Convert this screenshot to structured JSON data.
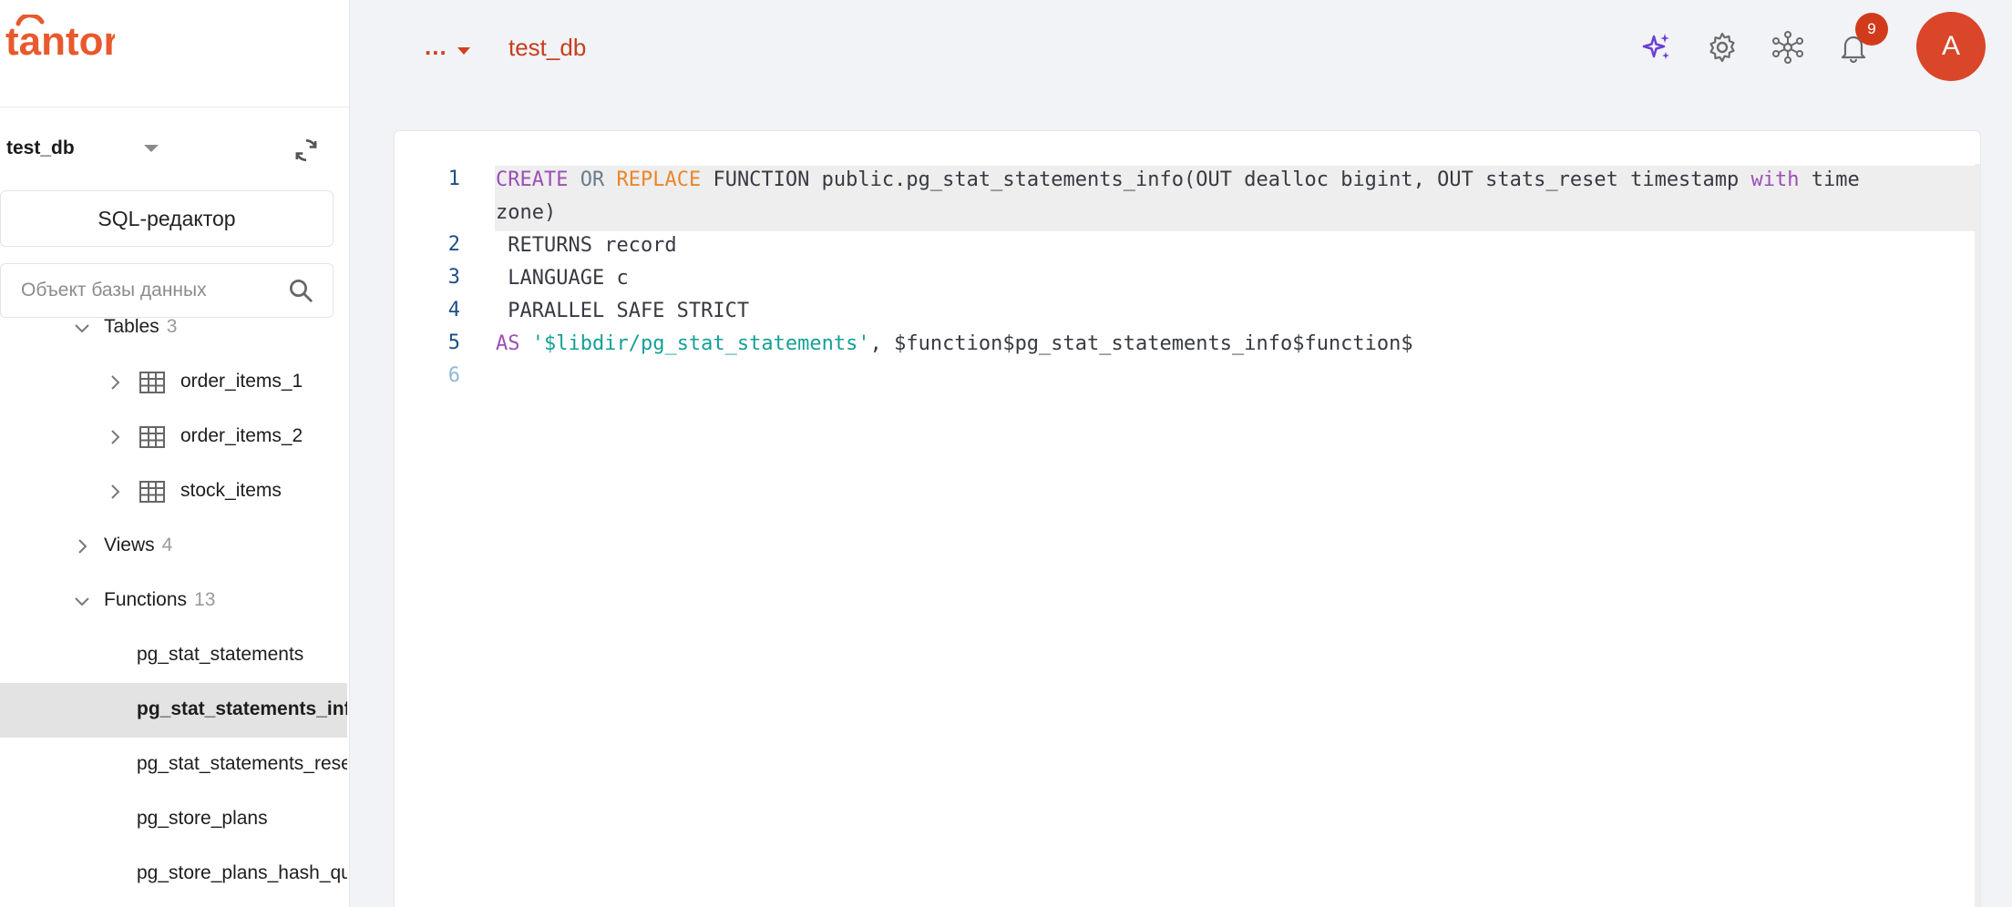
{
  "sidebar": {
    "db_selector": {
      "value": "test_db"
    },
    "sql_editor_button": "SQL-редактор",
    "search": {
      "placeholder": "Объект базы данных",
      "value": ""
    },
    "tree": [
      {
        "label": "Tables",
        "count": "3",
        "expanded": true
      },
      {
        "label": "order_items_1"
      },
      {
        "label": "order_items_2"
      },
      {
        "label": "stock_items"
      },
      {
        "label": "Views",
        "count": "4",
        "expanded": false
      },
      {
        "label": "Functions",
        "count": "13",
        "expanded": true
      },
      {
        "label": "pg_stat_statements"
      },
      {
        "label": "pg_stat_statements_info",
        "selected": true
      },
      {
        "label": "pg_stat_statements_reset"
      },
      {
        "label": "pg_store_plans"
      },
      {
        "label": "pg_store_plans_hash_query"
      }
    ]
  },
  "header": {
    "more_label": "...",
    "breadcrumb_db": "test_db",
    "notifications_count": "9",
    "avatar_letter": "A"
  },
  "editor": {
    "line_numbers": [
      "1",
      "2",
      "3",
      "4",
      "5",
      "6"
    ],
    "code": {
      "l1_create": "CREATE",
      "l1_or": "OR",
      "l1_replace": "REPLACE",
      "l1_rest": " FUNCTION public.pg_stat_statements_info(OUT dealloc bigint, OUT stats_reset timestamp ",
      "l1_with": "with",
      "l1_tail": " time",
      "l1_wrap": "zone)",
      "l2": " RETURNS record",
      "l3": " LANGUAGE c",
      "l4": " PARALLEL SAFE STRICT",
      "l5_as": "AS",
      "l5_str": "'$libdir/pg_stat_statements'",
      "l5_rest": ", $function$pg_stat_statements_info$function$"
    }
  },
  "colors": {
    "brand": "#d9462a",
    "keyword": "#9b4fb5",
    "keyword_orange": "#e8872b",
    "string": "#15a096",
    "line_number": "#1d4f8a"
  }
}
